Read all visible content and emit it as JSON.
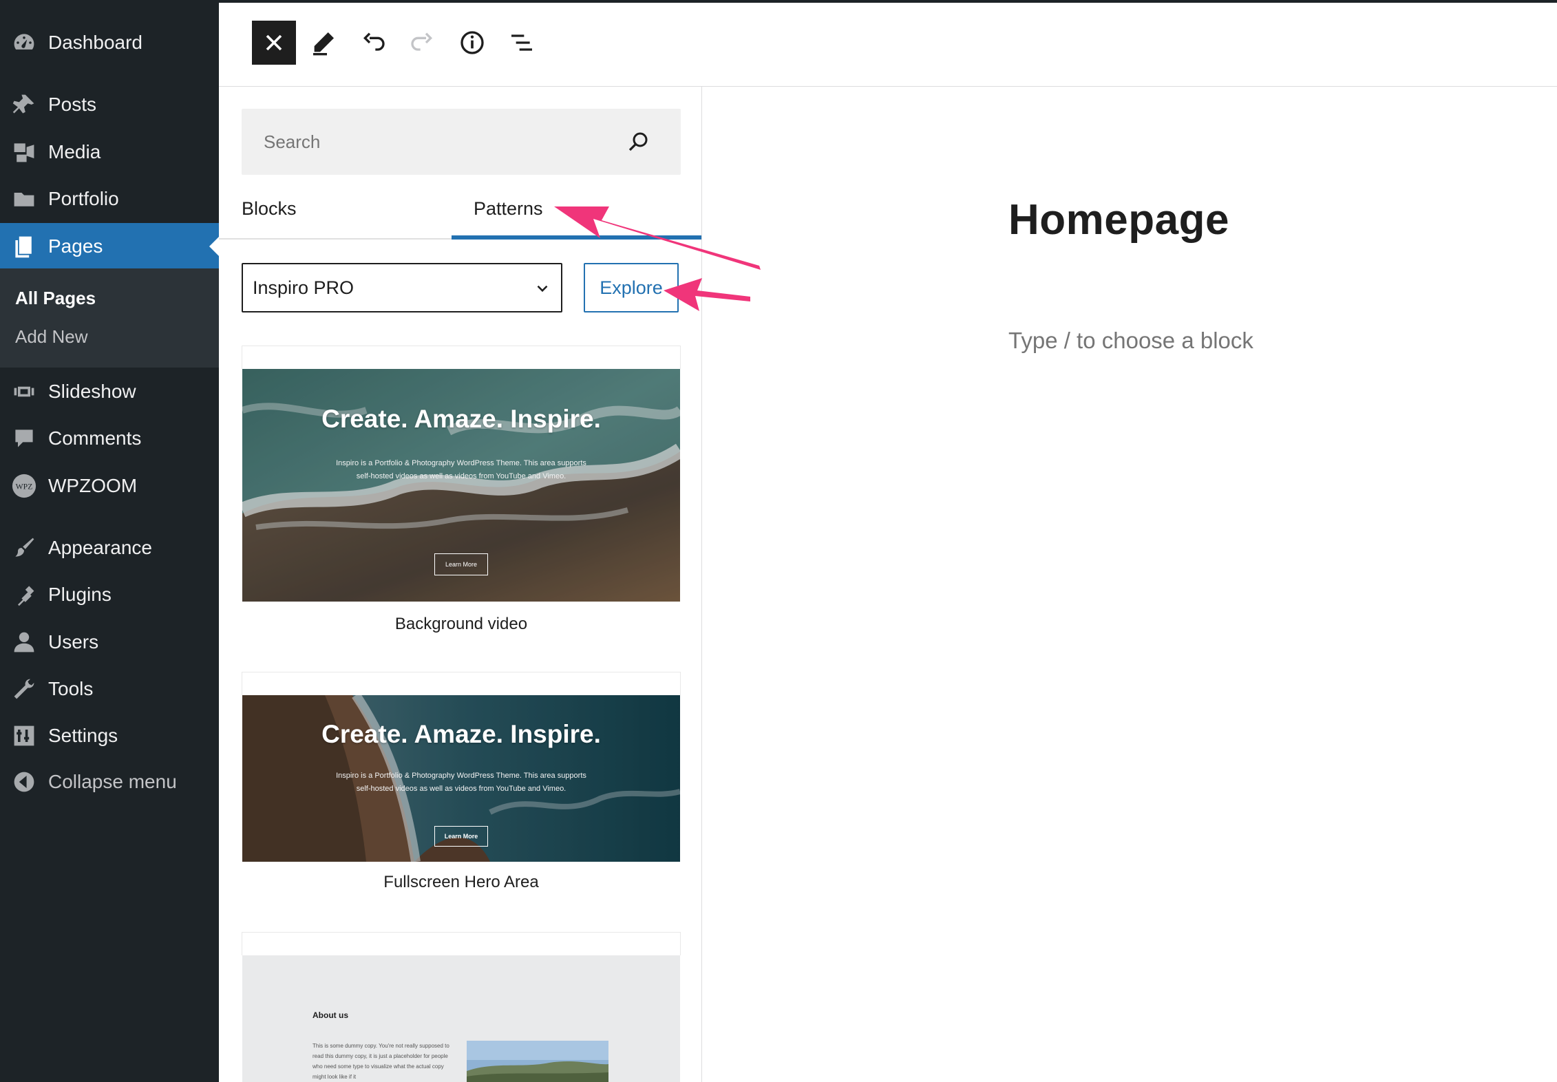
{
  "sidebar": {
    "items": [
      {
        "label": "Dashboard",
        "icon": "dashboard-icon"
      },
      {
        "label": "Posts",
        "icon": "pin-icon"
      },
      {
        "label": "Media",
        "icon": "media-icon"
      },
      {
        "label": "Portfolio",
        "icon": "folder-icon"
      },
      {
        "label": "Pages",
        "icon": "pages-icon",
        "current": true
      },
      {
        "label": "Slideshow",
        "icon": "slideshow-icon"
      },
      {
        "label": "Comments",
        "icon": "comment-icon"
      },
      {
        "label": "WPZOOM",
        "icon": "wpzoom-icon"
      },
      {
        "label": "Appearance",
        "icon": "brush-icon"
      },
      {
        "label": "Plugins",
        "icon": "plugin-icon"
      },
      {
        "label": "Users",
        "icon": "user-icon"
      },
      {
        "label": "Tools",
        "icon": "wrench-icon"
      },
      {
        "label": "Settings",
        "icon": "settings-icon"
      }
    ],
    "submenu": [
      {
        "label": "All Pages",
        "current": true
      },
      {
        "label": "Add New"
      }
    ],
    "collapse_label": "Collapse menu",
    "wpzoom_badge": "WPZ"
  },
  "toolbar": {
    "icons": [
      "close-icon",
      "pencil-icon",
      "undo-icon",
      "redo-icon",
      "info-icon",
      "list-view-icon"
    ]
  },
  "inserter": {
    "search_placeholder": "Search",
    "tabs": {
      "blocks": "Blocks",
      "patterns": "Patterns",
      "active": "patterns"
    },
    "category": "Inspiro PRO",
    "explore_label": "Explore",
    "patterns": [
      {
        "title": "Background video",
        "headline": "Create. Amaze. Inspire.",
        "sub_line1": "Inspiro is a Portfolio & Photography WordPress Theme. This area supports",
        "sub_line2": "self-hosted videos as well as videos from YouTube and Vimeo.",
        "button": "Learn More"
      },
      {
        "title": "Fullscreen Hero Area",
        "headline": "Create. Amaze. Inspire.",
        "sub_line1": "Inspiro is a Portfolio & Photography WordPress Theme. This area supports",
        "sub_line2": "self-hosted videos as well as videos from YouTube and Vimeo.",
        "button": "Learn More"
      },
      {
        "heading": "About us",
        "body": "This is some dummy copy. You're not really supposed to read this dummy copy, it is just a placeholder for people who need some type to visualize what the actual copy might look like if it"
      }
    ]
  },
  "canvas": {
    "page_title": "Homepage",
    "placeholder": "Type / to choose a block"
  },
  "colors": {
    "sidebar_bg": "#1d2327",
    "accent": "#2271b1",
    "annotation_arrow": "#f0357a"
  }
}
